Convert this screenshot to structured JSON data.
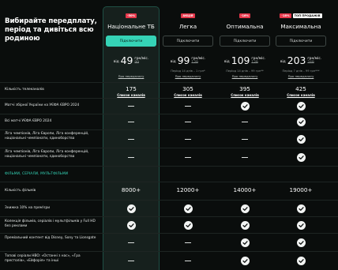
{
  "heading": "Вибирайте передплату, період та дивіться всю родиною",
  "plans": [
    {
      "name": "Національне ТБ",
      "badges": [
        {
          "text": "-50%",
          "style": "red"
        }
      ],
      "connect": "Підключити",
      "from": "від",
      "price": "49",
      "unit": "грн/міс.",
      "old": "99",
      "note": "",
      "link": "Про передплату",
      "primary": true
    },
    {
      "name": "Легка",
      "badges": [
        {
          "text": "АКЦІЯ",
          "style": "red"
        }
      ],
      "connect": "Підключити",
      "from": "від",
      "price": "99",
      "unit": "грн/міс.",
      "old": "129",
      "note": "Період 14 днів – 1 грн*",
      "link": "Про передплату",
      "primary": false
    },
    {
      "name": "Оптимальна",
      "badges": [
        {
          "text": "-16%",
          "style": "red"
        }
      ],
      "connect": "Підключити",
      "from": "від",
      "price": "109",
      "unit": "грн/міс.",
      "old": "129",
      "note": "Період 14 днів – 99 грн**",
      "link": "Про передплату",
      "primary": false
    },
    {
      "name": "Максимальна",
      "badges": [
        {
          "text": "-18%",
          "style": "red"
        },
        {
          "text": "ТОП ПРОДАЖІВ",
          "style": "white"
        }
      ],
      "connect": "Підключити",
      "from": "від",
      "price": "203",
      "unit": "грн/міс.",
      "old": "249",
      "note": "Період 7 днів – 99 грн***",
      "link": "Про передплату",
      "primary": false
    }
  ],
  "rows": [
    {
      "label": "Кількість телеканалів",
      "cells": [
        {
          "t": "text",
          "v": "175",
          "sub": "Список каналів"
        },
        {
          "t": "text",
          "v": "305",
          "sub": "Список каналів"
        },
        {
          "t": "text",
          "v": "395",
          "sub": "Список каналів"
        },
        {
          "t": "text",
          "v": "425",
          "sub": "Список каналів"
        }
      ]
    },
    {
      "label": "Матчі збірної України на УЄФА ЄВРО 2024",
      "cells": [
        {
          "t": "dash"
        },
        {
          "t": "dash"
        },
        {
          "t": "check"
        },
        {
          "t": "check"
        }
      ]
    },
    {
      "label": "Всі матчі УЄФА ЄВРО 2024",
      "cells": [
        {
          "t": "dash"
        },
        {
          "t": "dash"
        },
        {
          "t": "dash"
        },
        {
          "t": "check"
        }
      ]
    },
    {
      "label": "Ліга чемпіонів, Ліга Європи, Ліга конференцій, національні чемпіонати, єдиноборства",
      "cells": [
        {
          "t": "dash"
        },
        {
          "t": "dash"
        },
        {
          "t": "dash"
        },
        {
          "t": "check"
        }
      ]
    },
    {
      "label": "Ліга чемпіонів, Ліга Європи, Ліга конференцій, національні чемпіонати, єдиноборства",
      "cells": [
        {
          "t": "dash"
        },
        {
          "t": "dash"
        },
        {
          "t": "dash"
        },
        {
          "t": "check"
        }
      ]
    }
  ],
  "section_title": "ФІЛЬМИ, СЕРІАЛИ, МУЛЬТФІЛЬМИ",
  "rows2": [
    {
      "label": "Кількість фільмів",
      "cells": [
        {
          "t": "text",
          "v": "8000+"
        },
        {
          "t": "text",
          "v": "12000+"
        },
        {
          "t": "text",
          "v": "14000+"
        },
        {
          "t": "text",
          "v": "19000+"
        }
      ]
    },
    {
      "label": "Знижка 10% на прем'єри",
      "cells": [
        {
          "t": "check"
        },
        {
          "t": "check"
        },
        {
          "t": "check"
        },
        {
          "t": "check"
        }
      ]
    },
    {
      "label": "Колекція фільмів, серіалів і мультфільмів у Full HD без реклами",
      "cells": [
        {
          "t": "check"
        },
        {
          "t": "check"
        },
        {
          "t": "check"
        },
        {
          "t": "check"
        }
      ]
    },
    {
      "label": "Преміальний контент від Disney, Sony та Lionsgate",
      "cells": [
        {
          "t": "dash"
        },
        {
          "t": "dash"
        },
        {
          "t": "check"
        },
        {
          "t": "check"
        }
      ]
    },
    {
      "label": "Топові серіали HBO: «Останні з нас», «Гра престолів», «Ейфорія» та інші",
      "cells": [
        {
          "t": "dash"
        },
        {
          "t": "dash"
        },
        {
          "t": "check"
        },
        {
          "t": "check"
        }
      ]
    }
  ],
  "colors": {
    "accent": "#35d3b6",
    "badge": "#e6374b",
    "bg": "#0a0d0c",
    "highlight": "#16201d"
  }
}
